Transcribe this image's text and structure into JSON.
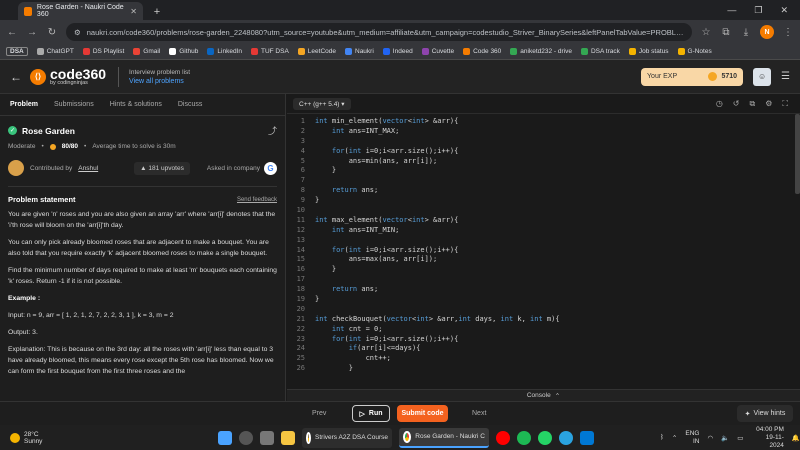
{
  "browser": {
    "tab_title": "Rose Garden - Naukri Code 360",
    "url": "naukri.com/code360/problems/rose-garden_2248080?utm_source=youtube&utm_medium=affiliate&utm_campaign=codestudio_Striver_BinarySeries&leftPanelTabValue=PROBLEM",
    "profile_initial": "N",
    "bookmarks": [
      "DSA",
      "ChatGPT",
      "DS Playlist",
      "Gmail",
      "Github",
      "LinkedIn",
      "TUF DSA",
      "LeetCode",
      "Naukri",
      "Indeed",
      "Cuvette",
      "Code 360",
      "aniketd232 - drive",
      "DSA track",
      "Job status",
      "G-Notes"
    ],
    "bookmark_colors": [
      "#888888",
      "#aaaaaa",
      "#e53935",
      "#ea4335",
      "#ffffff",
      "#0a66c2",
      "#e53935",
      "#f5a623",
      "#4285f4",
      "#2164f3",
      "#8e44ad",
      "#f57c00",
      "#34a853",
      "#34a853",
      "#f5b400",
      "#f5b400"
    ]
  },
  "app": {
    "logo_text": "code360",
    "logo_sub": "by codingninjas",
    "interview_label": "Interview problem list",
    "view_all": "View all problems",
    "exp_label": "Your EXP",
    "exp_value": "5710"
  },
  "left": {
    "tabs": [
      "Problem",
      "Submissions",
      "Hints & solutions",
      "Discuss"
    ],
    "title": "Rose Garden",
    "difficulty": "Moderate",
    "score": "80/80",
    "avg_time": "Average time to solve is 30m",
    "contributed_by": "Contributed by",
    "author": "Anshul",
    "upvotes": "181 upvotes",
    "asked_in": "Asked in company",
    "statement_heading": "Problem statement",
    "send_feedback": "Send feedback",
    "paragraphs": [
      "You are given 'n' roses and you are also given an array 'arr' where 'arr[i]' denotes that the 'i'th rose will bloom on the 'arr[i]'th day.",
      "You can only pick already bloomed roses that are adjacent to make a bouquet. You are also told that you require exactly 'k' adjacent bloomed roses to make a single bouquet.",
      "Find the minimum number of days required to make at least 'm' bouquets each containing 'k' roses. Return -1 if it is not possible.",
      "Example :",
      "Input: n = 9,  arr = [ 1, 2, 1, 2, 7, 2, 2, 3, 1 ], k = 3, m = 2",
      "Output: 3.",
      "Explanation: This is because on the 3rd day: all the roses with 'arr[i]' less than equal to 3 have already bloomed, this means every rose except the 5th rose has bloomed. Now we can form the first bouquet from the first three roses and the"
    ]
  },
  "editor": {
    "language": "C++ (g++ 5.4)",
    "lines": [
      "int min_element(vector<int> &arr){",
      "    int ans=INT_MAX;",
      "",
      "    for(int i=0;i<arr.size();i++){",
      "        ans=min(ans, arr[i]);",
      "    }",
      "",
      "    return ans;",
      "}",
      "",
      "int max_element(vector<int> &arr){",
      "    int ans=INT_MIN;",
      "",
      "    for(int i=0;i<arr.size();i++){",
      "        ans=max(ans, arr[i]);",
      "    }",
      "",
      "    return ans;",
      "}",
      "",
      "int checkBouquet(vector<int> &arr,int days, int k, int m){",
      "    int cnt = 0;",
      "    for(int i=0;i<arr.size();i++){",
      "        if(arr[i]<=days){",
      "            cnt++;",
      "        }"
    ],
    "console_label": "Console"
  },
  "actions": {
    "prev": "Prev",
    "run": "Run",
    "submit": "Submit code",
    "next": "Next",
    "hints": "View hints"
  },
  "taskbar": {
    "temp": "28°C",
    "weather": "Sunny",
    "apps": [
      "Strivers A2Z DSA Course",
      "Rose Garden - Naukri C"
    ],
    "lang": "ENG",
    "region": "IN",
    "time": "04:00 PM",
    "date": "19-11-2024"
  }
}
